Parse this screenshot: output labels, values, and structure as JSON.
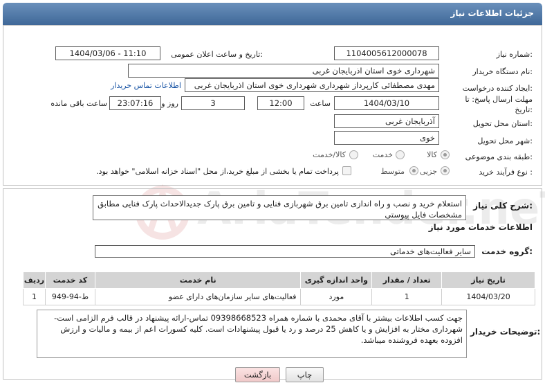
{
  "header": {
    "title": "جزئیات اطلاعات نیاز"
  },
  "need_number": {
    "label": "شماره نیاز:",
    "value": "1104005612000078"
  },
  "announce": {
    "label": "تاریخ و ساعت اعلان عمومی:",
    "value": "1404/03/06 - 11:10"
  },
  "buyer_org": {
    "label": "نام دستگاه خریدار:",
    "value": "شهرداری خوی استان اذربایجان غربی"
  },
  "requester": {
    "label": "ایجاد کننده درخواست:",
    "value": "مهدی مصطفائی کارپرداز شهرداری شهرداری خوی استان اذربایجان غربی",
    "contact_link": "اطلاعات تماس خریدار"
  },
  "deadline": {
    "label_line1": "مهلت ارسال پاسخ: تا",
    "label_line2": "تاریخ:",
    "date": "1404/03/10",
    "time_label": "ساعت",
    "time": "12:00",
    "days": "3",
    "days_label": "روز و",
    "remaining": "23:07:16",
    "remaining_label": "ساعت باقی مانده"
  },
  "delivery_province": {
    "label": "استان محل تحویل:",
    "value": "آذربایجان غربی"
  },
  "delivery_city": {
    "label": "شهر محل تحویل:",
    "value": "خوی"
  },
  "category": {
    "label": "طبقه بندی موضوعی:",
    "options": [
      "کالا",
      "خدمت",
      "کالا/خدمت"
    ],
    "selected": "کالا"
  },
  "purchase_process": {
    "label": "نوع فرآیند خرید :",
    "options": [
      "جزیی",
      "متوسط"
    ],
    "selected": "جزیی",
    "payment_note": "پرداخت تمام یا بخشی از مبلغ خرید،از محل \"اسناد خزانه اسلامی\" خواهد بود."
  },
  "description": {
    "label": "شرح کلی نیاز:",
    "text": "استعلام خرید و نصب و راه اندازی تامین برق شهربازی فنایی و تامین برق پارک جدیدالاحداث پارک فنایی مطابق مشخصات فایل پیوستی"
  },
  "services_title": "اطلاعات خدمات مورد نیاز",
  "service_group": {
    "label": "گروه خدمت:",
    "value": "سایر فعالیت‌های خدماتی"
  },
  "table": {
    "headers": [
      "ردیف",
      "کد خدمت",
      "نام خدمت",
      "واحد اندازه گیری",
      "تعداد / مقدار",
      "تاریخ نیاز"
    ],
    "rows": [
      [
        "1",
        "ط-94-949",
        "فعالیت‌های سایر سازمان‌های دارای عضو",
        "مورد",
        "1",
        "1404/03/20"
      ]
    ]
  },
  "buyer_notes": {
    "label": "توضیحات خریدار:",
    "text": "جهت کسب اطلاعات بیشتر با آقای محمدی با شماره همراه 09398668523 تماس-ارائه پیشنهاد در قالب فرم الزامی است-شهرداری مختار به افزایش و یا کاهش 25 درصد و رد یا قبول پیشنهادات است. کلیه کسورات اعم از بیمه و مالیات و ارزش افزوده بعهده فروشنده میباشد."
  },
  "buttons": {
    "print": "چاپ",
    "back": "بازگشت"
  },
  "watermark": {
    "text": "AriaTender.neT"
  }
}
